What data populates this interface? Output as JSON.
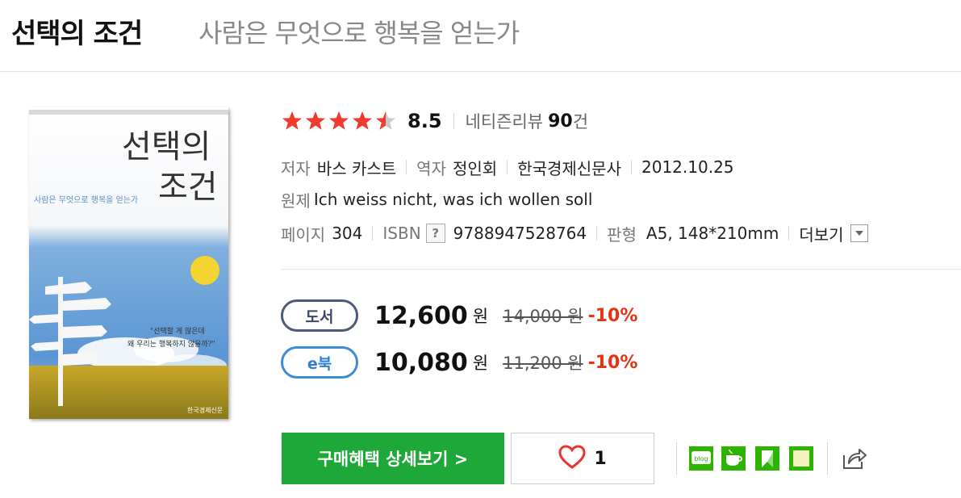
{
  "header": {
    "title": "선택의 조건",
    "subtitle": "사람은 무엇으로 행복을 얻는가"
  },
  "cover": {
    "title_line1": "선택의",
    "title_line2": "조건",
    "subtitle": "사람은 무엇으로 행복을 얻는가",
    "quote_line1": "\"선택할 게 많은데",
    "quote_line2": "왜 우리는 행복하지 않을까?\"",
    "publisher": "한국경제신문"
  },
  "rating": {
    "stars": 4.5,
    "max_stars": 5,
    "score": "8.5",
    "review_label": "네티즌리뷰",
    "review_count": "90",
    "review_unit": "건"
  },
  "meta": {
    "author_label": "저자",
    "author": "바스 카스트",
    "translator_label": "역자",
    "translator": "정인회",
    "publisher": "한국경제신문사",
    "date": "2012.10.25",
    "original_label": "원제",
    "original_title": "Ich weiss nicht, was ich wollen soll",
    "pages_label": "페이지",
    "pages": "304",
    "isbn_label": "ISBN",
    "isbn_help": "?",
    "isbn": "9788947528764",
    "format_label": "판형",
    "format": "A5, 148*210mm",
    "more_label": "더보기"
  },
  "prices": [
    {
      "type": "도서",
      "price": "12,600",
      "unit": "원",
      "original": "14,000 원",
      "discount": "-10%"
    },
    {
      "type": "e북",
      "price": "10,080",
      "unit": "원",
      "original": "11,200 원",
      "discount": "-10%"
    }
  ],
  "actions": {
    "buy_label": "구매혜택 상세보기 >",
    "like_count": "1",
    "blog_label": "blog"
  },
  "colors": {
    "star": "#f03c2e",
    "buy_green": "#1fa83a",
    "discount_red": "#e63312",
    "ebook_blue": "#3d8bd6",
    "book_navy": "#4f5a78"
  }
}
